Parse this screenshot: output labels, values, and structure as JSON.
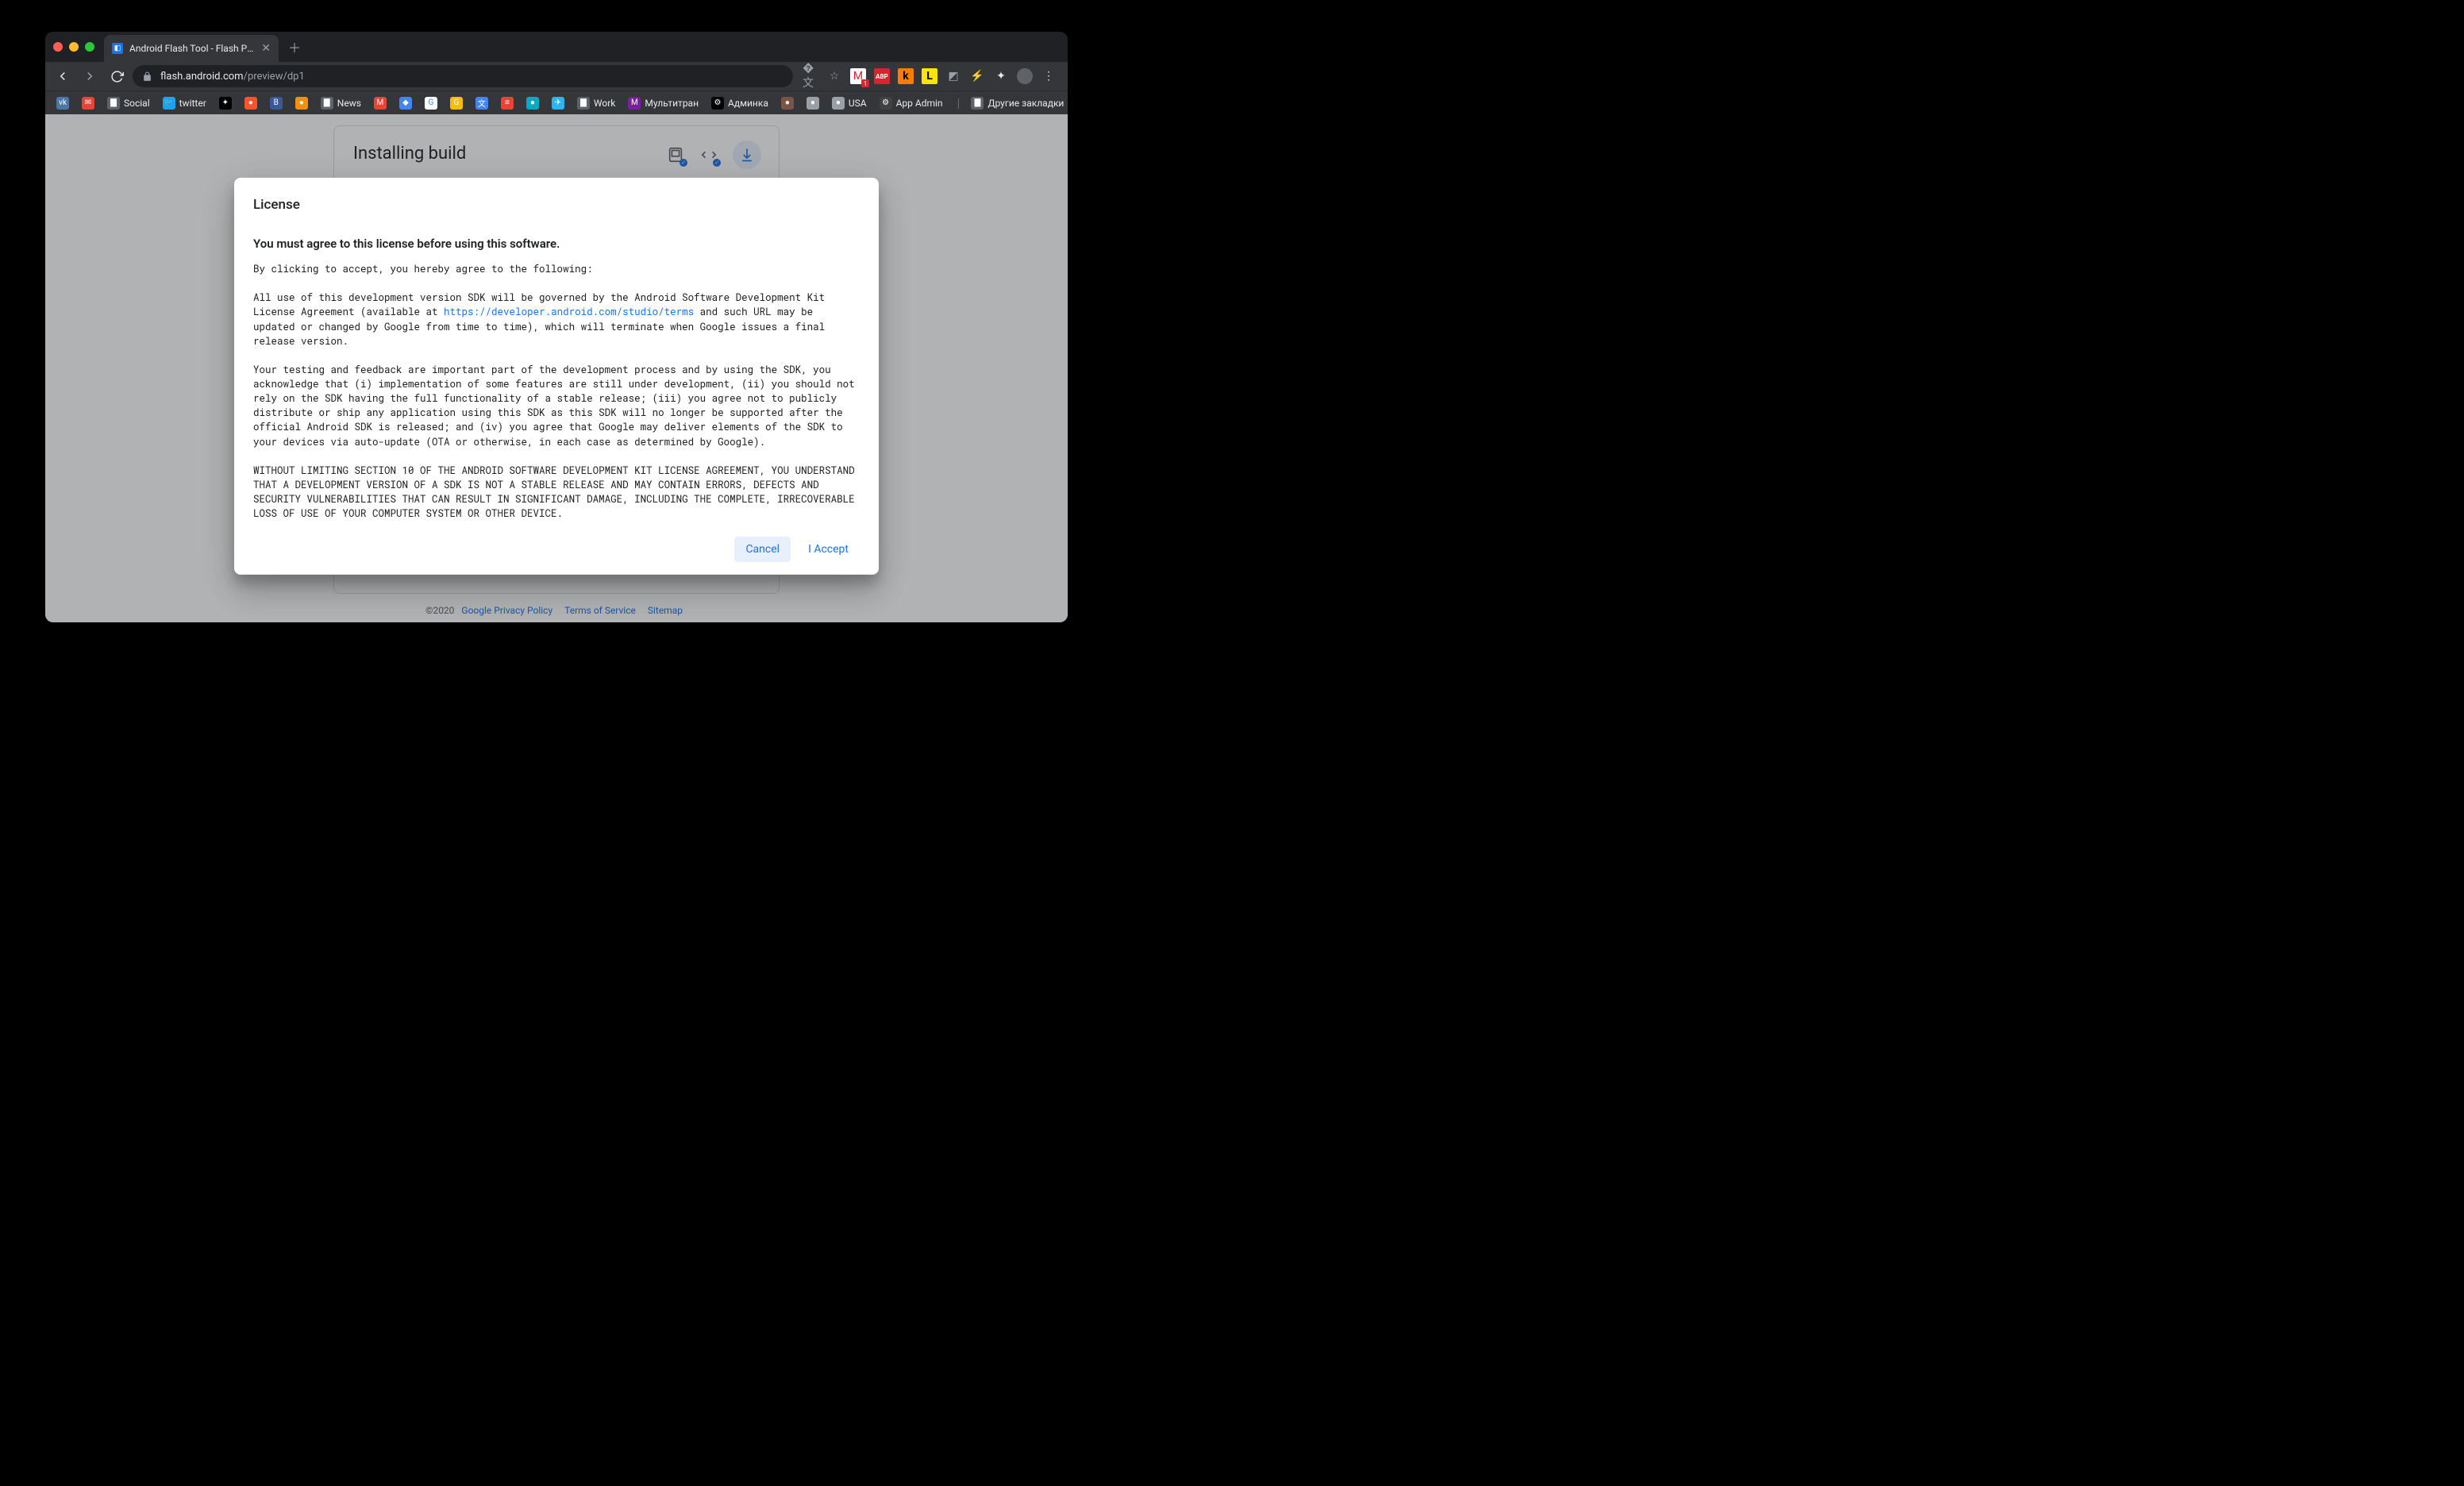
{
  "tab": {
    "title": "Android Flash Tool - Flash Prev"
  },
  "url": {
    "host": "flash.android.com",
    "path": "/preview/dp1"
  },
  "bookmarks": [
    {
      "label": "",
      "icon": "vk",
      "bg": "#4a76a8"
    },
    {
      "label": "",
      "icon": "gmail",
      "bg": "#ea4335"
    },
    {
      "label": "Social",
      "icon": "folder",
      "bg": "#5f6368"
    },
    {
      "label": "twitter",
      "icon": "twitter",
      "bg": "#1da1f2"
    },
    {
      "label": "",
      "icon": "spark",
      "bg": "#000"
    },
    {
      "label": "",
      "icon": "brave",
      "bg": "#fb542b"
    },
    {
      "label": "",
      "icon": "B",
      "bg": "#3b5998"
    },
    {
      "label": "",
      "icon": "cookie",
      "bg": "#f29111"
    },
    {
      "label": "News",
      "icon": "folder",
      "bg": "#5f6368"
    },
    {
      "label": "",
      "icon": "M",
      "bg": "#ea4335"
    },
    {
      "label": "",
      "icon": "drop",
      "bg": "#4285f4"
    },
    {
      "label": "",
      "icon": "G",
      "bg": "#fff"
    },
    {
      "label": "",
      "icon": "Gy",
      "bg": "#fbbc04"
    },
    {
      "label": "",
      "icon": "tr",
      "bg": "#4285f4"
    },
    {
      "label": "",
      "icon": "red",
      "bg": "#ea4335"
    },
    {
      "label": "",
      "icon": "teal",
      "bg": "#00acc1"
    },
    {
      "label": "",
      "icon": "tg",
      "bg": "#29b6f6"
    },
    {
      "label": "Work",
      "icon": "folder",
      "bg": "#5f6368"
    },
    {
      "label": "Мультитран",
      "icon": "mt",
      "bg": "#7b1fa2"
    },
    {
      "label": "Админка",
      "icon": "admin",
      "bg": "#000"
    },
    {
      "label": "",
      "icon": "dot",
      "bg": "#795548"
    },
    {
      "label": "",
      "icon": "apple",
      "bg": "#9aa0a6"
    },
    {
      "label": "USA",
      "icon": "apple",
      "bg": "#9aa0a6"
    },
    {
      "label": "App Admin",
      "icon": "app",
      "bg": "#424242"
    }
  ],
  "other_bookmarks": "Другие закладки",
  "card": {
    "title": "Installing build"
  },
  "footer": {
    "copyright": "©2020",
    "links": [
      "Google Privacy Policy",
      "Terms of Service",
      "Sitemap"
    ]
  },
  "dialog": {
    "title": "License",
    "heading": "You must agree to this license before using this software.",
    "intro": "By clicking to accept, you hereby agree to the following:",
    "p1a": "All use of this development version SDK will be governed by the Android Software Development Kit License Agreement (available at ",
    "link": "https://developer.android.com/studio/terms",
    "p1b": " and such URL may be updated or changed by Google from time to time), which will terminate when Google issues a final release version.",
    "p2": "Your testing and feedback are important part of the development process and by using the SDK, you acknowledge that (i) implementation of some features are still under development, (ii) you should not rely on the SDK having the full functionality of a stable release; (iii) you agree not to publicly distribute or ship any application using this SDK as this SDK will no longer be supported after the official Android SDK is released; and (iv) you agree that Google may deliver elements of the SDK to your devices via auto-update (OTA or otherwise, in each case as determined by Google).",
    "p3": "WITHOUT LIMITING SECTION 10 OF THE ANDROID SOFTWARE DEVELOPMENT KIT LICENSE AGREEMENT, YOU UNDERSTAND THAT A DEVELOPMENT VERSION OF A SDK IS NOT A STABLE RELEASE AND MAY CONTAIN ERRORS, DEFECTS AND SECURITY VULNERABILITIES THAT CAN RESULT IN SIGNIFICANT DAMAGE, INCLUDING THE COMPLETE, IRRECOVERABLE LOSS OF USE OF YOUR COMPUTER SYSTEM OR OTHER DEVICE.",
    "cancel": "Cancel",
    "accept": "I Accept"
  }
}
